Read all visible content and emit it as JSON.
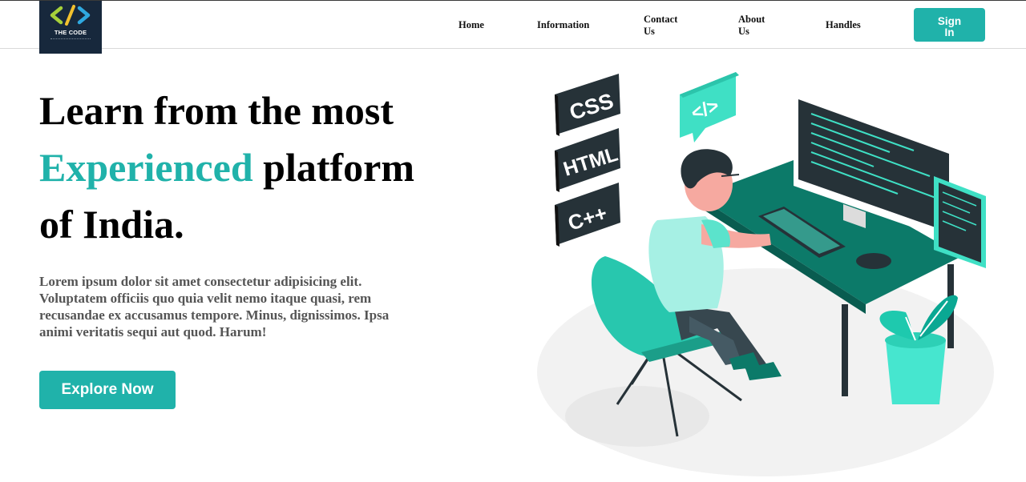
{
  "brand": {
    "logo_glyph": "</>",
    "name": "THE CODE",
    "colors": {
      "logo_bg": "#17283c",
      "accent": "#20b2aa"
    }
  },
  "nav": {
    "links": [
      "Home",
      "Information",
      "Contact Us",
      "About Us",
      "Handles"
    ],
    "contact_line1": "Contact",
    "contact_line2": "Us",
    "about_line1": "About",
    "about_line2": "Us",
    "signin_line1": "Sign",
    "signin_line2": "In"
  },
  "hero": {
    "headline_line1": "Learn from the most",
    "headline_accent": "Experienced",
    "headline_line2_rest": " platform",
    "headline_line3": "of India.",
    "lead": "Lorem ipsum dolor sit amet consectetur adipisicing elit. Voluptatem officiis quo quia velit nemo itaque quasi, rem recusandae ex accusamus tempore. Minus, dignissimos. Ipsa animi veritatis sequi aut quod. Harum!",
    "cta_label": "Explore Now"
  },
  "illustration": {
    "tags": [
      "CSS",
      "HTML",
      "C++"
    ],
    "code_badge": "</>",
    "icons": [
      "code-tag-icon",
      "developer-at-desk-illustration"
    ]
  }
}
